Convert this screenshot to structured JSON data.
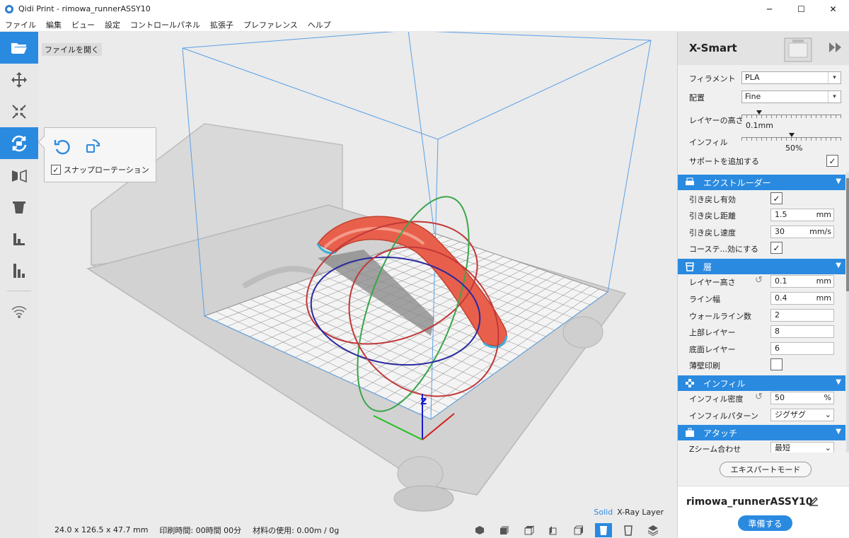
{
  "window": {
    "title": "Qidi Print - rimowa_runnerASSY10",
    "minimize": "─",
    "maximize": "☐",
    "close": "✕"
  },
  "menu": [
    "ファイル",
    "編集",
    "ビュー",
    "設定",
    "コントロールパネル",
    "拡張子",
    "プレファレンス",
    "ヘルプ"
  ],
  "toolbar": {
    "items": [
      {
        "name": "open-folder-icon",
        "active": true
      },
      {
        "name": "move-icon",
        "active": false
      },
      {
        "name": "scale-icon",
        "active": false
      },
      {
        "name": "rotate-icon",
        "active": true
      },
      {
        "name": "mirror-icon",
        "active": false
      },
      {
        "name": "per-model-settings-icon",
        "active": false
      },
      {
        "name": "support-blocker-icon",
        "active": false
      },
      {
        "name": "layer-view-icon",
        "active": false
      },
      {
        "name": "wifi-icon",
        "active": false
      }
    ]
  },
  "viewport": {
    "open_file_label": "ファイルを開く",
    "rotate_popup": {
      "snap_label": "スナップローテーション",
      "snap_checked": true
    },
    "view_mode": {
      "solid": "Solid",
      "xray": "X-Ray",
      "layer": "Layer"
    }
  },
  "status": {
    "dimensions": "24.0 x 126.5 x 47.7 mm",
    "print_time": "印刷時間: 00時間 00分",
    "material": "材料の使用: 0.00m / 0g"
  },
  "panel": {
    "printer": "X-Smart",
    "filament_label": "フィラメント",
    "filament_value": "PLA",
    "profile_label": "配置",
    "profile_value": "Fine",
    "layer_height_label": "レイヤーの高さ",
    "layer_height_value": "0.1mm",
    "layer_height_fraction": 0.18,
    "infill_label": "インフィル",
    "infill_value": "50%",
    "infill_fraction": 0.5,
    "support_label": "サポートを追加する",
    "support_checked": true,
    "sections": {
      "extruder": {
        "title": "エクストルーダー",
        "retraction_enable_label": "引き戻し有効",
        "retraction_distance_label": "引き戻し距離",
        "retraction_distance_value": "1.5",
        "retraction_distance_unit": "mm",
        "retraction_speed_label": "引き戻し速度",
        "retraction_speed_value": "30",
        "retraction_speed_unit": "mm/s",
        "coasting_label": "コーステ...効にする"
      },
      "shell": {
        "title": "層",
        "layer_height_label": "レイヤー高さ",
        "layer_height_value": "0.1",
        "layer_height_unit": "mm",
        "line_width_label": "ライン幅",
        "line_width_value": "0.4",
        "line_width_unit": "mm",
        "wall_count_label": "ウォールライン数",
        "wall_count_value": "2",
        "top_layers_label": "上部レイヤー",
        "top_layers_value": "8",
        "bottom_layers_label": "底面レイヤー",
        "bottom_layers_value": "6",
        "thin_wall_label": "薄壁印刷"
      },
      "infill": {
        "title": "インフィル",
        "density_label": "インフィル密度",
        "density_value": "50",
        "density_unit": "%",
        "pattern_label": "インフィルパターン",
        "pattern_value": "ジグザグ"
      },
      "adhesion": {
        "title": "アタッチ",
        "z_seam_label": "Zシーム合わせ",
        "z_seam_value": "最短"
      }
    },
    "expert_mode": "エキスパートモード",
    "file_name": "rimowa_runnerASSY10",
    "prepare": "準備する"
  },
  "colors": {
    "accent": "#2a8ae0",
    "model": "#e8604c",
    "build_volume": "#5aa0e6"
  }
}
